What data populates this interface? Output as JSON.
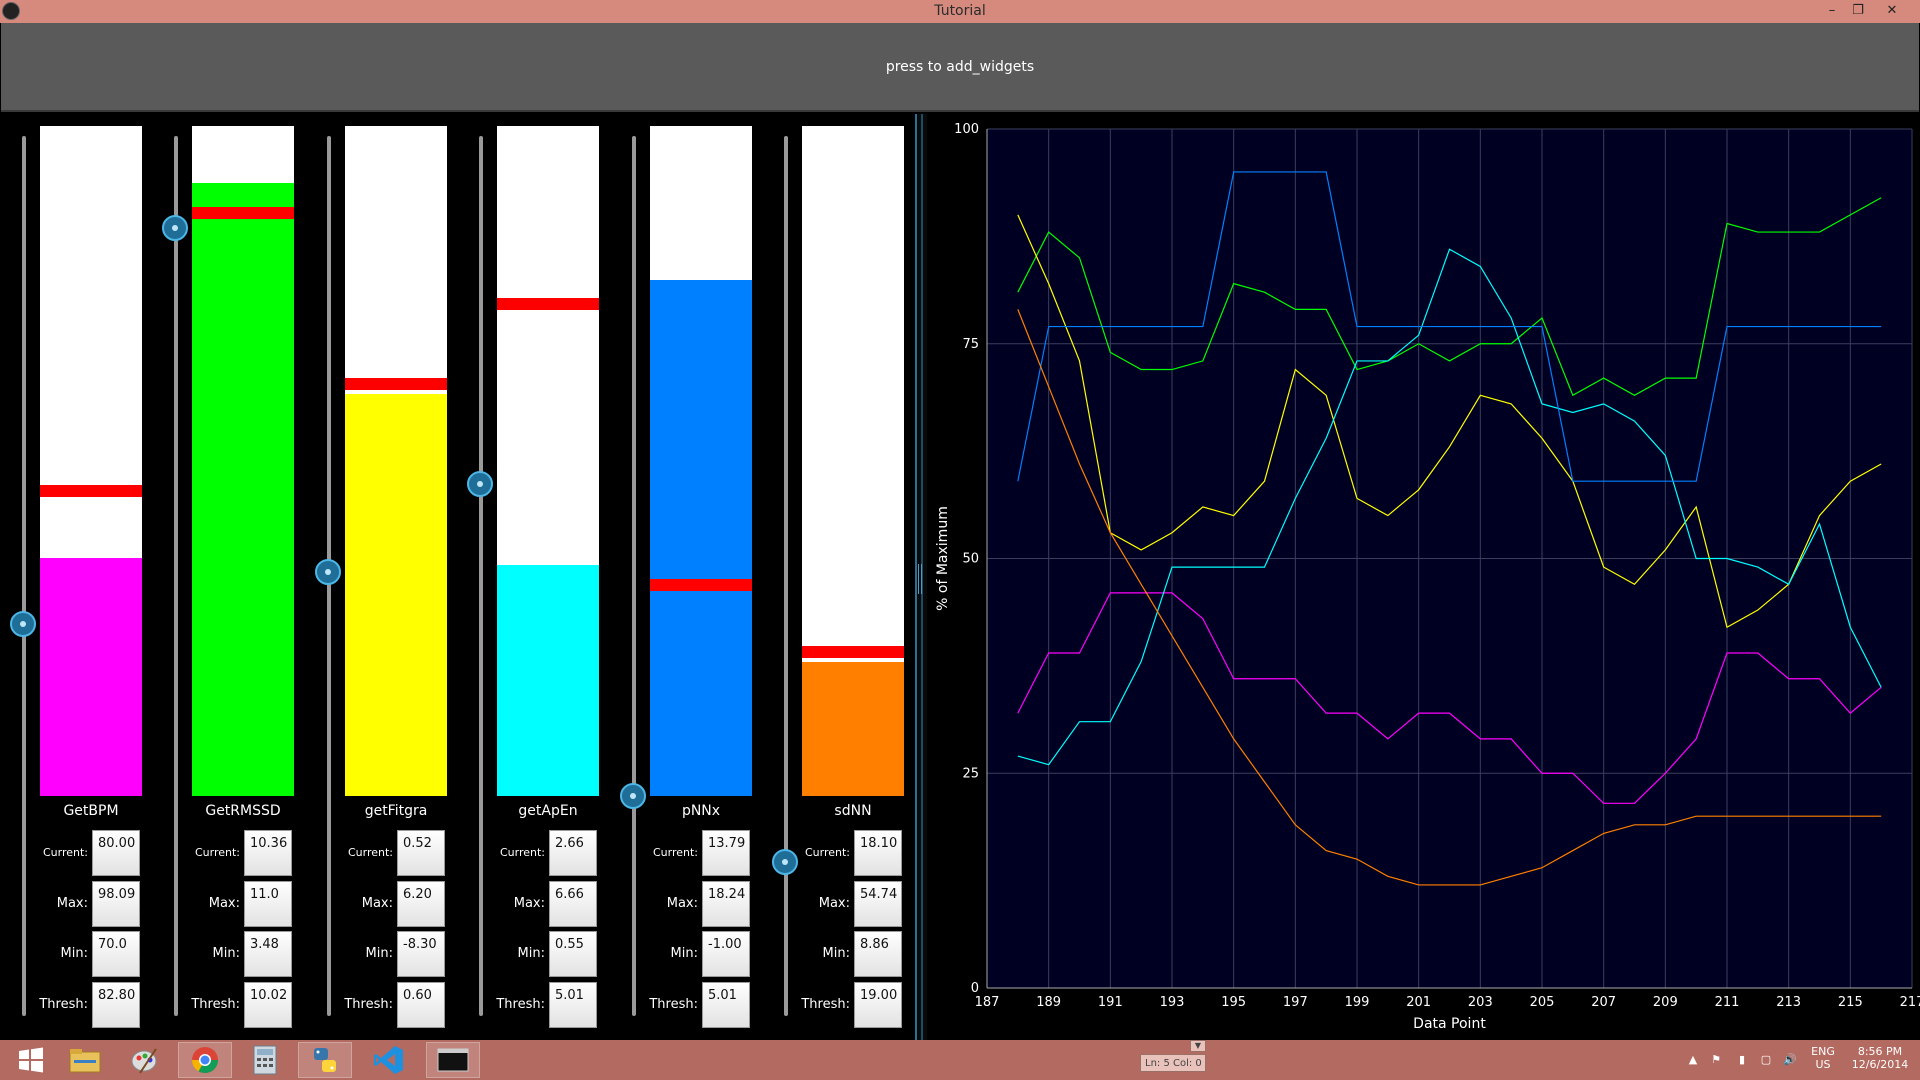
{
  "window": {
    "title": "Tutorial",
    "controls": [
      "minimize",
      "restore",
      "close"
    ]
  },
  "add_button": {
    "label": "press to add_widgets"
  },
  "stat_labels": {
    "current": "Current:",
    "max": "Max:",
    "min": "Min:",
    "thresh": "Thresh:"
  },
  "gauges": [
    {
      "name": "GetBPM",
      "color": "#ff00ff",
      "fill_fraction": 0.355,
      "thresh_fraction": 0.455,
      "slider_fraction": 0.445,
      "current": "80.00",
      "max": "98.09",
      "min": "70.0",
      "thresh": "82.80"
    },
    {
      "name": "GetRMSSD",
      "color": "#00ff00",
      "fill_fraction": 0.915,
      "thresh_fraction": 0.87,
      "slider_fraction": 0.895,
      "current": "10.36",
      "max": "11.0",
      "min": "3.48",
      "thresh": "10.02"
    },
    {
      "name": "getFitgra",
      "color": "#ffff00",
      "fill_fraction": 0.6,
      "thresh_fraction": 0.615,
      "slider_fraction": 0.505,
      "current": "0.52",
      "max": "6.20",
      "min": "-8.30",
      "thresh": "0.60"
    },
    {
      "name": "getApEn",
      "color": "#00ffff",
      "fill_fraction": 0.345,
      "thresh_fraction": 0.735,
      "slider_fraction": 0.605,
      "current": "2.66",
      "max": "6.66",
      "min": "0.55",
      "thresh": "5.01"
    },
    {
      "name": "pNNx",
      "color": "#0080ff",
      "fill_fraction": 0.77,
      "thresh_fraction": 0.315,
      "slider_fraction": 0.25,
      "current": "13.79",
      "max": "18.24",
      "min": "-1.00",
      "thresh": "5.01"
    },
    {
      "name": "sdNN",
      "color": "#ff8000",
      "fill_fraction": 0.2,
      "thresh_fraction": 0.215,
      "slider_fraction": 0.175,
      "current": "18.10",
      "max": "54.74",
      "min": "8.86",
      "thresh": "19.00"
    }
  ],
  "chart_data": {
    "type": "line",
    "title": "",
    "xlabel": "Data Point",
    "ylabel": "% of Maximum",
    "xlim": [
      187,
      217
    ],
    "ylim": [
      0,
      100
    ],
    "xticks": [
      187,
      189,
      191,
      193,
      195,
      197,
      199,
      201,
      203,
      205,
      207,
      209,
      211,
      213,
      215,
      217
    ],
    "yticks": [
      0,
      25,
      50,
      75,
      100
    ],
    "grid": true,
    "background": "#000022",
    "x": [
      188,
      189,
      190,
      191,
      192,
      193,
      194,
      195,
      196,
      197,
      198,
      199,
      200,
      201,
      202,
      203,
      204,
      205,
      206,
      207,
      208,
      209,
      210,
      211,
      212,
      213,
      214,
      215,
      216
    ],
    "series": [
      {
        "color": "#ff00ff",
        "values": [
          32,
          39,
          39,
          46,
          46,
          46,
          43,
          36,
          36,
          36,
          32,
          32,
          29,
          32,
          32,
          29,
          29,
          25,
          25,
          21.5,
          21.5,
          25,
          29,
          39,
          39,
          36,
          36,
          32,
          35
        ]
      },
      {
        "color": "#00ff00",
        "values": [
          81,
          88,
          85,
          74,
          72,
          72,
          73,
          82,
          81,
          79,
          79,
          72,
          73,
          75,
          73,
          75,
          75,
          78,
          69,
          71,
          69,
          71,
          71,
          89,
          88,
          88,
          88,
          90,
          92
        ]
      },
      {
        "color": "#ffff00",
        "values": [
          90,
          82,
          73,
          53,
          51,
          53,
          56,
          55,
          59,
          72,
          69,
          57,
          55,
          58,
          63,
          69,
          68,
          64,
          59,
          49,
          47,
          51,
          56,
          42,
          44,
          47,
          55,
          59,
          61
        ]
      },
      {
        "color": "#00ffff",
        "values": [
          27,
          26,
          31,
          31,
          38,
          49,
          49,
          49,
          49,
          57,
          64,
          73,
          73,
          76,
          86,
          84,
          78,
          68,
          67,
          68,
          66,
          62,
          50,
          50,
          49,
          47,
          54,
          42,
          35
        ]
      },
      {
        "color": "#0080ff",
        "values": [
          59,
          77,
          77,
          77,
          77,
          77,
          77,
          95,
          95,
          95,
          95,
          77,
          77,
          77,
          77,
          77,
          77,
          77,
          59,
          59,
          59,
          59,
          59,
          77,
          77,
          77,
          77,
          77,
          77
        ]
      },
      {
        "color": "#ff8000",
        "values": [
          79,
          70,
          61,
          53,
          47,
          41,
          35,
          29,
          24,
          19,
          16,
          15,
          13,
          12,
          12,
          12,
          13,
          14,
          16,
          18,
          19,
          19,
          20,
          20,
          20,
          20,
          20,
          20,
          20
        ]
      }
    ]
  },
  "taskbar": {
    "status_text": "Ln: 5 Col: 0",
    "language": "ENG",
    "region": "US",
    "time": "8:56 PM",
    "date": "12/6/2014"
  }
}
